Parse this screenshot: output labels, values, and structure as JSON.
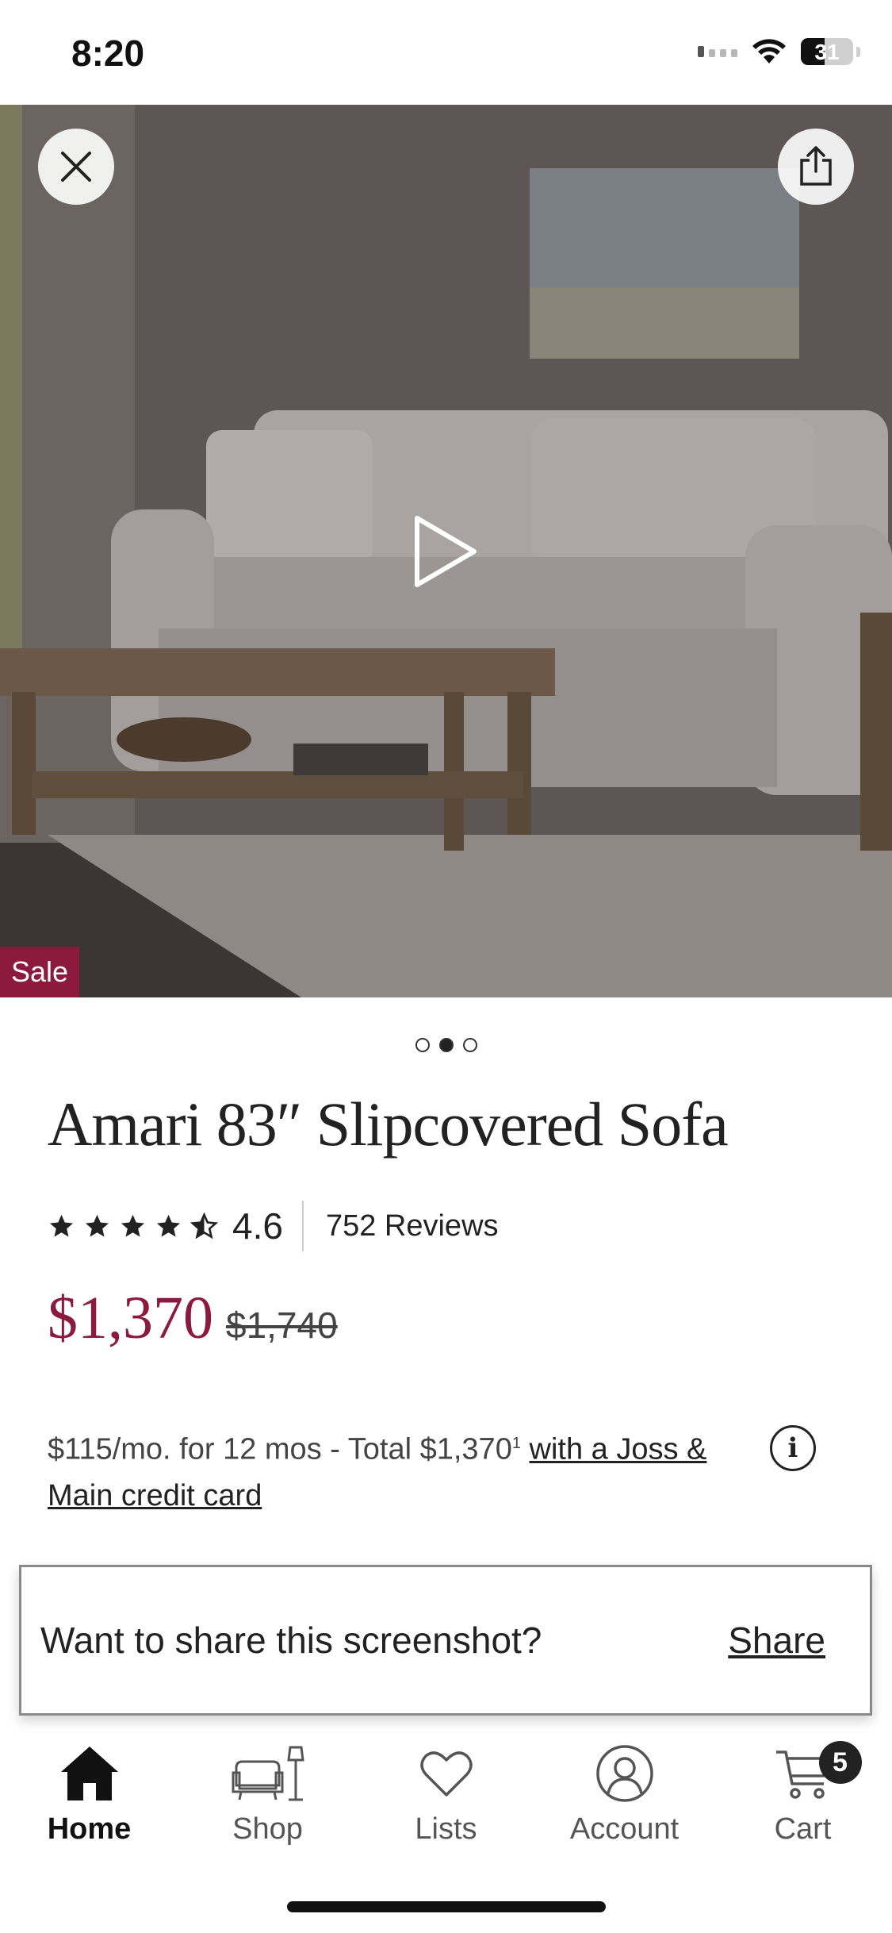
{
  "status_bar": {
    "time": "8:20",
    "battery_level": "31"
  },
  "media": {
    "sale_badge": "Sale",
    "carousel": {
      "count": 3,
      "active_index": 1
    },
    "icons": {
      "close": "close-icon",
      "share": "share-icon",
      "play": "play-icon"
    }
  },
  "product": {
    "title": "Amari 83″ Slipcovered Sofa",
    "rating": {
      "stars": 4.6,
      "value": "4.6",
      "reviews": "752 Reviews"
    },
    "price": {
      "sale": "$1,370",
      "original": "$1,740",
      "sale_color": "#8b1a3d"
    },
    "financing": {
      "text": "$115/mo. for 12 mos - Total $1,370",
      "footnote": "1",
      "link": "with a Joss & Main credit card"
    }
  },
  "share_banner": {
    "prompt": "Want to share this screenshot?",
    "action": "Share"
  },
  "tab_bar": {
    "tabs": [
      {
        "label": "Home",
        "icon": "home-icon",
        "active": true
      },
      {
        "label": "Shop",
        "icon": "shop-icon",
        "active": false
      },
      {
        "label": "Lists",
        "icon": "heart-icon",
        "active": false
      },
      {
        "label": "Account",
        "icon": "account-icon",
        "active": false
      },
      {
        "label": "Cart",
        "icon": "cart-icon",
        "active": false
      }
    ],
    "cart_count": "5"
  }
}
